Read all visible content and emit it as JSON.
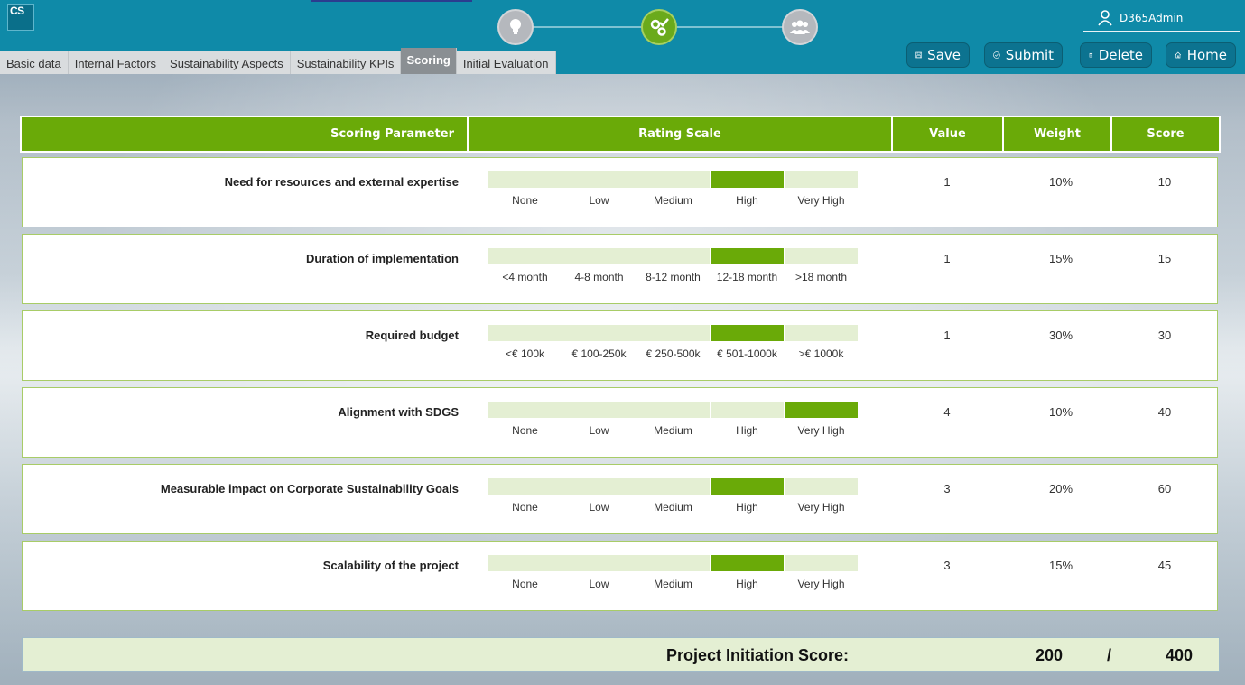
{
  "logo": {
    "text": "CS"
  },
  "user": {
    "name": "D365Admin"
  },
  "steps": [
    {
      "icon": "lightbulb-icon",
      "state": "inactive"
    },
    {
      "icon": "gears-check-icon",
      "state": "active"
    },
    {
      "icon": "group-icon",
      "state": "inactive"
    }
  ],
  "actions": {
    "save": "Save",
    "submit": "Submit",
    "delete": "Delete",
    "home": "Home"
  },
  "tabs": [
    {
      "label": "Basic data",
      "active": false
    },
    {
      "label": "Internal Factors",
      "active": false
    },
    {
      "label": "Sustainability Aspects",
      "active": false
    },
    {
      "label": "Sustainability KPIs",
      "active": false
    },
    {
      "label": "Scoring",
      "active": true
    },
    {
      "label": "Initial Evaluation",
      "active": false
    }
  ],
  "columns": {
    "param": "Scoring Parameter",
    "scale": "Rating Scale",
    "value": "Value",
    "weight": "Weight",
    "score": "Score"
  },
  "rows": [
    {
      "param": "Need for resources and external expertise",
      "scale": [
        "None",
        "Low",
        "Medium",
        "High",
        "Very High"
      ],
      "selected": 3,
      "value": "1",
      "weight": "10%",
      "score": "10"
    },
    {
      "param": "Duration of implementation",
      "scale": [
        "<4 month",
        "4-8 month",
        "8-12 month",
        "12-18 month",
        ">18 month"
      ],
      "selected": 3,
      "value": "1",
      "weight": "15%",
      "score": "15"
    },
    {
      "param": "Required budget",
      "scale": [
        "<€ 100k",
        "€ 100-250k",
        "€ 250-500k",
        "€ 501-1000k",
        ">€ 1000k"
      ],
      "selected": 3,
      "value": "1",
      "weight": "30%",
      "score": "30"
    },
    {
      "param": "Alignment with SDGS",
      "scale": [
        "None",
        "Low",
        "Medium",
        "High",
        "Very High"
      ],
      "selected": 4,
      "value": "4",
      "weight": "10%",
      "score": "40"
    },
    {
      "param": "Measurable impact on Corporate Sustainability Goals",
      "scale": [
        "None",
        "Low",
        "Medium",
        "High",
        "Very High"
      ],
      "selected": 3,
      "value": "3",
      "weight": "20%",
      "score": "60"
    },
    {
      "param": "Scalability of the project",
      "scale": [
        "None",
        "Low",
        "Medium",
        "High",
        "Very High"
      ],
      "selected": 3,
      "value": "3",
      "weight": "15%",
      "score": "45"
    }
  ],
  "total": {
    "label": "Project Initiation Score:",
    "score": "200",
    "separator": "/",
    "max": "400"
  },
  "colors": {
    "header": "#0f8aa8",
    "accent_green": "#6aaa08",
    "light_green": "#e4efd3"
  }
}
